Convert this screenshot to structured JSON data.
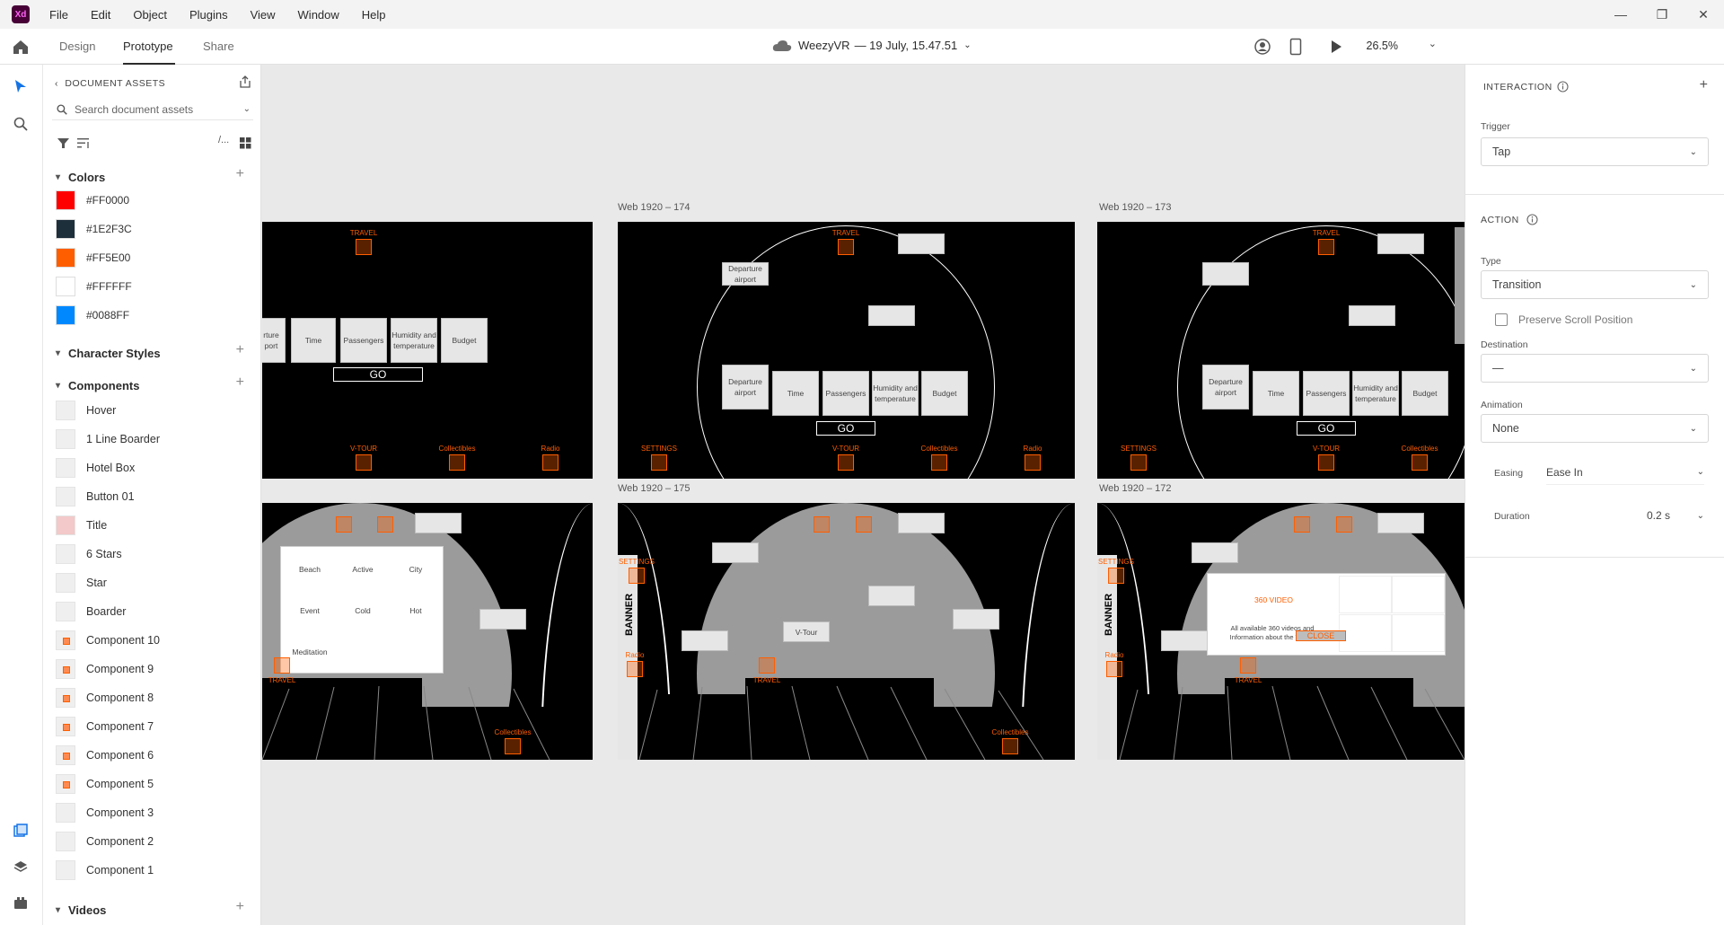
{
  "app": {
    "logo": "Xd"
  },
  "menubar": {
    "items": [
      "File",
      "Edit",
      "Object",
      "Plugins",
      "View",
      "Window",
      "Help"
    ]
  },
  "header": {
    "tabs": [
      "Design",
      "Prototype",
      "Share"
    ],
    "doc_name": "WeezyVR",
    "doc_meta": "— 19 July, 15.47.51",
    "zoom": "26.5%"
  },
  "assets": {
    "title": "DOCUMENT ASSETS",
    "search_placeholder": "Search document assets",
    "colors_heading": "Colors",
    "colors": [
      {
        "hex": "#FF0000",
        "label": "#FF0000"
      },
      {
        "hex": "#1E2F3C",
        "label": "#1E2F3C"
      },
      {
        "hex": "#FF5E00",
        "label": "#FF5E00"
      },
      {
        "hex": "#FFFFFF",
        "label": "#FFFFFF"
      },
      {
        "hex": "#0088FF",
        "label": "#0088FF"
      }
    ],
    "char_styles_heading": "Character Styles",
    "components_heading": "Components",
    "components": [
      "Hover",
      "1 Line Boarder",
      "Hotel Box",
      "Button 01",
      "Title",
      "6 Stars",
      "Star",
      "Boarder",
      "Component 10",
      "Component 9",
      "Component 8",
      "Component 7",
      "Component 6",
      "Component 5",
      "Component 3",
      "Component 2",
      "Component 1"
    ],
    "videos_heading": "Videos"
  },
  "canvas": {
    "artboards": {
      "a174": "Web 1920 – 174",
      "a173": "Web 1920 – 173",
      "a175": "Web 1920 – 175",
      "a172": "Web 1920 – 172"
    },
    "labels": {
      "travel": "TRAVEL",
      "vtour": "V-TOUR",
      "collectibles": "Collectibles",
      "radio": "Radio",
      "settings": "SETTINGS",
      "go": "GO",
      "departure": "Departure airport",
      "departure_cut": "rture\nport",
      "time": "Time",
      "passengers": "Passengers",
      "humidity": "Humidity and temperature",
      "budget": "Budget",
      "beach": "Beach",
      "active": "Active",
      "city": "City",
      "event": "Event",
      "cold": "Cold",
      "hot": "Hot",
      "meditation": "Meditation",
      "banner": "BANNER",
      "v_tour_btn": "V-Tour",
      "video360": "360 VIDEO",
      "video_desc": "All available 360 videos and Information about the V-Tour",
      "close": "CLOSE"
    }
  },
  "inspector": {
    "interaction_heading": "INTERACTION",
    "trigger_label": "Trigger",
    "trigger_value": "Tap",
    "action_heading": "ACTION",
    "type_label": "Type",
    "type_value": "Transition",
    "preserve_scroll": "Preserve Scroll Position",
    "destination_label": "Destination",
    "destination_value": "—",
    "animation_label": "Animation",
    "animation_value": "None",
    "easing_label": "Easing",
    "easing_value": "Ease In",
    "duration_label": "Duration",
    "duration_value": "0.2 s"
  }
}
